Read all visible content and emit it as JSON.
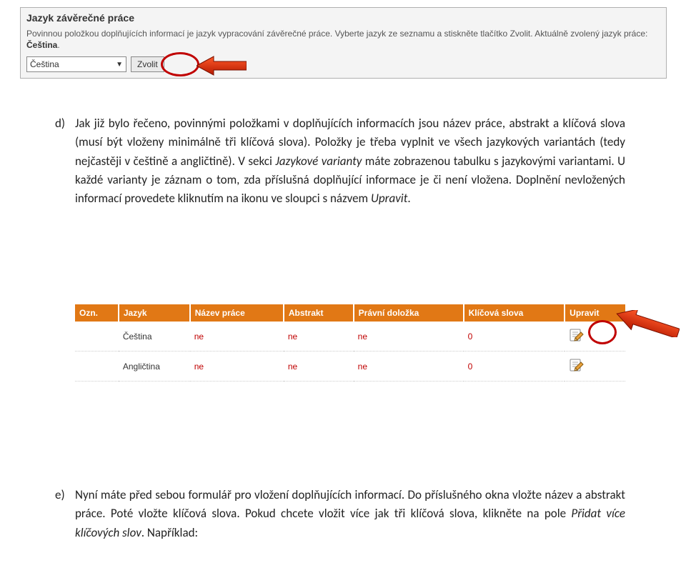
{
  "figure1": {
    "title": "Jazyk závěrečné práce",
    "body_pre": "Povinnou položkou doplňujících informací je jazyk vypracování závěrečné práce. Vyberte jazyk ze seznamu a stiskněte tlačítko Zvolit. Aktuálně zvolený jazyk práce: ",
    "body_bold": "Čeština",
    "body_post": ".",
    "select_value": "Čeština",
    "button_label": "Zvolit"
  },
  "para_d": {
    "marker": "d)",
    "t1": "Jak již bylo řečeno, povinnými položkami v doplňujících informacích jsou název práce, abstrakt a klíčová slova (musí být vloženy minimálně tři klíčová slova). Položky je třeba vyplnit ve všech jazykových variantách (tedy nejčastěji v češtině a angličtině). V sekci ",
    "i1": "Jazykové varianty",
    "t2": " máte zobrazenou tabulku s jazykovými variantami. U každé varianty je záznam o tom, zda příslušná doplňující informace je či není vložena. Doplnění nevložených informací provedete kliknutím na ikonu ve sloupci s názvem ",
    "i2": "Upravit",
    "t3": "."
  },
  "table": {
    "headers": [
      "Ozn.",
      "Jazyk",
      "Název práce",
      "Abstrakt",
      "Právní doložka",
      "Klíčová slova",
      "Upravit"
    ],
    "rows": [
      {
        "lang": "Čeština",
        "nazev": "ne",
        "abstrakt": "ne",
        "dolozka": "ne",
        "klicova": "0"
      },
      {
        "lang": "Angličtina",
        "nazev": "ne",
        "abstrakt": "ne",
        "dolozka": "ne",
        "klicova": "0"
      }
    ]
  },
  "para_e": {
    "marker": "e)",
    "t1": "Nyní máte před sebou formulář pro vložení doplňujících informací. Do příslušného okna vložte název a abstrakt práce. Poté vložte klíčová slova. Pokud chcete vložit více jak tři klíčová slova, klikněte na pole ",
    "i1": "Přidat více klíčových slov",
    "t2": ". Například:"
  },
  "icons": {
    "edit": "edit-icon",
    "arrow": "red-arrow-icon",
    "circle": "highlight-circle"
  }
}
